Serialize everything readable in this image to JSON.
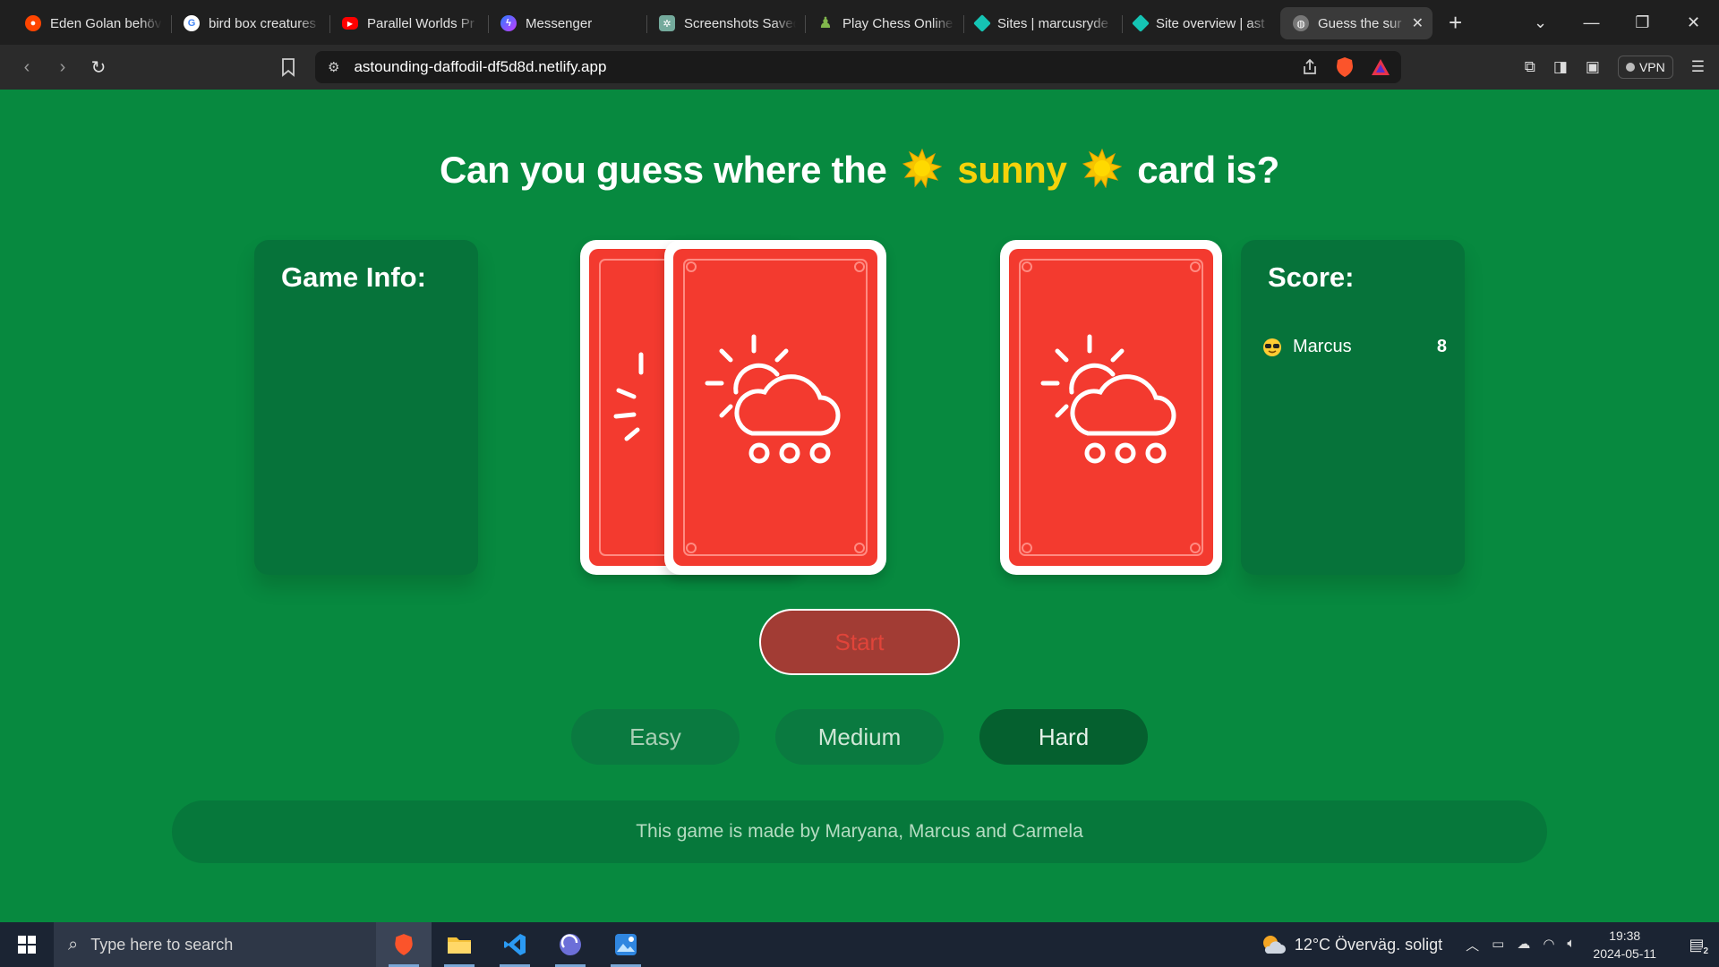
{
  "browser": {
    "tabs": [
      {
        "title": "Eden Golan behöv",
        "icon": "reddit-icon",
        "color": "#ff4500"
      },
      {
        "title": "bird box creatures",
        "icon": "google-icon",
        "color": "#ffffff"
      },
      {
        "title": "Parallel Worlds Pr",
        "icon": "youtube-icon",
        "color": "#ff0000"
      },
      {
        "title": "Messenger",
        "icon": "messenger-icon",
        "color": "#7b5cff"
      },
      {
        "title": "Screenshots Saved",
        "icon": "openai-icon",
        "color": "#74aa9c"
      },
      {
        "title": "Play Chess Online",
        "icon": "chess-pawn-icon",
        "color": "#81b64c"
      },
      {
        "title": "Sites | marcusryde",
        "icon": "netlify-icon",
        "color": "#15c4b4"
      },
      {
        "title": "Site overview | ast",
        "icon": "netlify-icon",
        "color": "#15c4b4"
      },
      {
        "title": "Guess the sur",
        "icon": "globe-icon",
        "color": "#bbbbbb",
        "active": true
      }
    ],
    "url": "astounding-daffodil-df5d8d.netlify.app",
    "vpn_label": "VPN"
  },
  "game": {
    "headline_pre": "Can you guess where the",
    "headline_sun": "sunny",
    "headline_post": "card is?",
    "info_title": "Game Info:",
    "score_title": "Score:",
    "scores": [
      {
        "name": "Marcus",
        "points": "8"
      }
    ],
    "start_label": "Start",
    "difficulties": [
      "Easy",
      "Medium",
      "Hard"
    ],
    "footer": "This game is made by Maryana, Marcus and Carmela",
    "colors": {
      "background": "#07893f",
      "card": "#f33a2f",
      "accent": "#f5d20a"
    }
  },
  "taskbar": {
    "search_placeholder": "Type here to search",
    "weather": "12°C  Överväg. soligt",
    "time": "19:38",
    "date": "2024-05-11",
    "notifications": "2"
  }
}
